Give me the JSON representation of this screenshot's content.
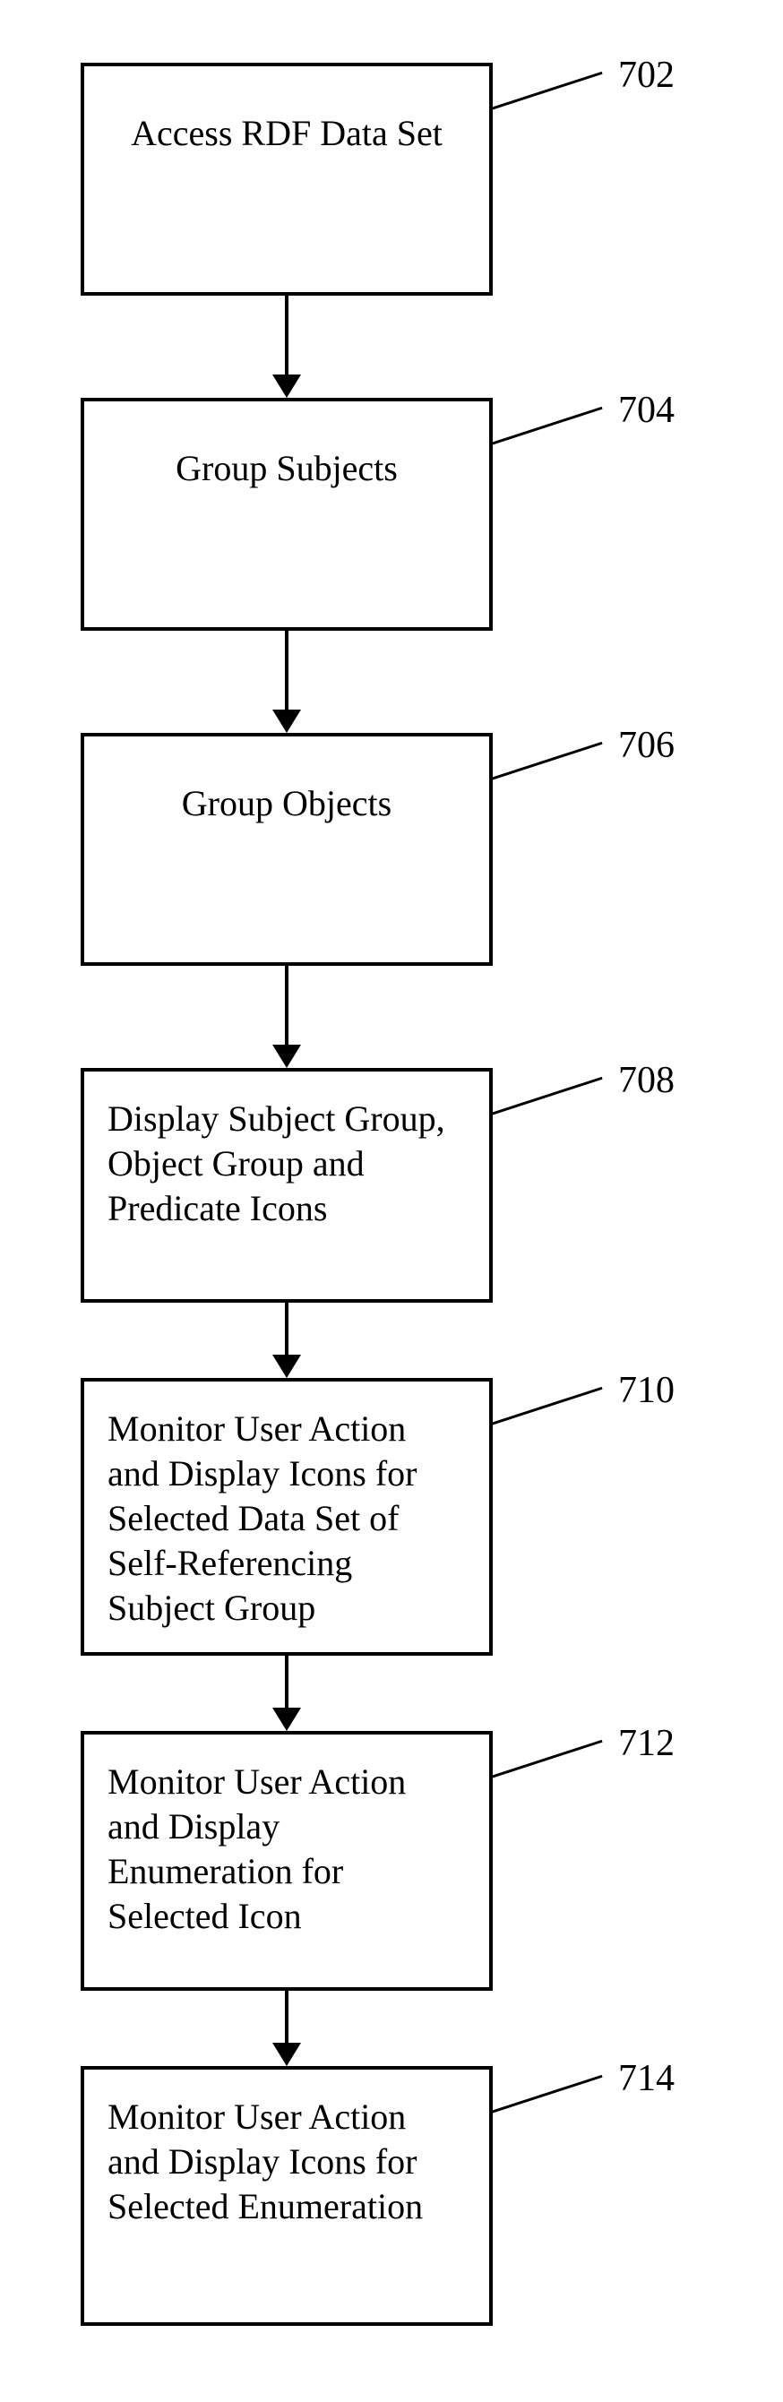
{
  "chart_data": {
    "type": "flowchart",
    "steps": [
      {
        "id": "702",
        "text": "Access RDF Data Set"
      },
      {
        "id": "704",
        "text": "Group Subjects"
      },
      {
        "id": "706",
        "text": "Group Objects"
      },
      {
        "id": "708",
        "text": "Display Subject Group, Object Group and Predicate Icons"
      },
      {
        "id": "710",
        "text": "Monitor User Action and Display Icons for Selected Data Set of Self-Referencing Subject Group"
      },
      {
        "id": "712",
        "text": "Monitor User Action and Display Enumeration for Selected Icon"
      },
      {
        "id": "714",
        "text": "Monitor User Action and Display Icons for Selected Enumeration"
      }
    ],
    "edges": [
      [
        "702",
        "704"
      ],
      [
        "704",
        "706"
      ],
      [
        "706",
        "708"
      ],
      [
        "708",
        "710"
      ],
      [
        "710",
        "712"
      ],
      [
        "712",
        "714"
      ]
    ]
  }
}
